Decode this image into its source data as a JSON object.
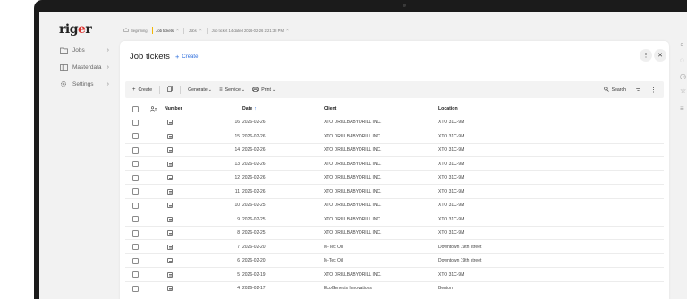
{
  "app": {
    "logo": "rig",
    "logo_accent": "e",
    "logo_end": "r",
    "accent_color": "#2f6fdd",
    "brand_color": "#d9302c"
  },
  "sidebar": {
    "items": [
      {
        "label": "Jobs",
        "icon": "folder-icon"
      },
      {
        "label": "Masterdata",
        "icon": "database-icon"
      },
      {
        "label": "Settings",
        "icon": "gear-icon"
      }
    ]
  },
  "tabs": [
    {
      "label": "Beginning",
      "icon": "home-icon"
    },
    {
      "label": "Job tickets",
      "active": true
    },
    {
      "label": "Jobs"
    },
    {
      "label": "Job ticket 14 dated 2026-02-26 2:21:38 PM"
    }
  ],
  "panel": {
    "title": "Job tickets",
    "create_label": "Create"
  },
  "toolbar": {
    "create_label": "Create",
    "generate_label": "Generate",
    "service_label": "Service",
    "print_label": "Print",
    "search_label": "Search"
  },
  "table": {
    "columns": [
      "Number",
      "Date",
      "Client",
      "Location"
    ],
    "sort_column": "Date",
    "rows": [
      {
        "number": "16",
        "date": "2026-02-26",
        "client": "XTO DRILLBABYDRILL INC.",
        "location": "XTO 31C-9M"
      },
      {
        "number": "15",
        "date": "2026-02-26",
        "client": "XTO DRILLBABYDRILL INC.",
        "location": "XTO 31C-9M"
      },
      {
        "number": "14",
        "date": "2026-02-26",
        "client": "XTO DRILLBABYDRILL INC.",
        "location": "XTO 31C-9M"
      },
      {
        "number": "13",
        "date": "2026-02-26",
        "client": "XTO DRILLBABYDRILL INC.",
        "location": "XTO 31C-9M"
      },
      {
        "number": "12",
        "date": "2026-02-26",
        "client": "XTO DRILLBABYDRILL INC.",
        "location": "XTO 31C-9M"
      },
      {
        "number": "11",
        "date": "2026-02-26",
        "client": "XTO DRILLBABYDRILL INC.",
        "location": "XTO 31C-9M"
      },
      {
        "number": "10",
        "date": "2026-02-25",
        "client": "XTO DRILLBABYDRILL INC.",
        "location": "XTO 31C-9M"
      },
      {
        "number": "9",
        "date": "2026-02-25",
        "client": "XTO DRILLBABYDRILL INC.",
        "location": "XTO 31C-9M"
      },
      {
        "number": "8",
        "date": "2026-02-25",
        "client": "XTO DRILLBABYDRILL INC.",
        "location": "XTO 31C-9M"
      },
      {
        "number": "7",
        "date": "2026-02-20",
        "client": "M-Tex Oil",
        "location": "Downtown 19th street"
      },
      {
        "number": "6",
        "date": "2026-02-20",
        "client": "M-Tex Oil",
        "location": "Downtown 19th street"
      },
      {
        "number": "5",
        "date": "2026-02-19",
        "client": "XTO DRILLBABYDRILL INC.",
        "location": "XTO 31C-9M"
      },
      {
        "number": "4",
        "date": "2026-02-17",
        "client": "EcoGenesis Innovations",
        "location": "Benton"
      }
    ]
  }
}
